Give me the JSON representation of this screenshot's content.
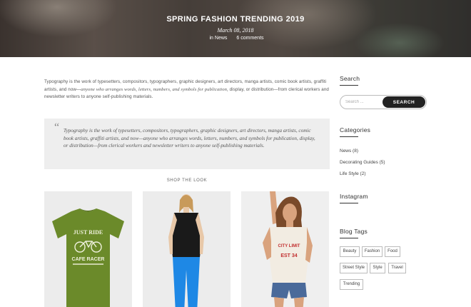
{
  "hero": {
    "title": "SPRING FASHION TRENDING 2019",
    "date": "March 08, 2018",
    "in_label": "in",
    "category": "News",
    "comments": "6 comments"
  },
  "article": {
    "intro_plain": "Typography is the work of typesetters, compositors, typographers, graphic designers, art directors, manga artists, comic book artists, graffiti artists, and now—",
    "intro_italic": "anyone who arranges words, letters, numbers, and symbols for publication,",
    "intro_tail": " display, or distribution—from clerical workers and newsletter writers to anyone self-publishing materials.",
    "quote_mark": "“",
    "quote": "Typography is the work of typesetters, compositors, typographers, graphic designers, art directors, manga artists, comic book artists, graffiti artists, and now—anyone who arranges words, letters, numbers, and symbols for publication, display, or distribution—from clerical workers and newsletter writers to anyone self-publishing materials.",
    "shop_label": "SHOP THE LOOK",
    "tshirt_line1": "JUST RIDE",
    "tshirt_line2": "CAFE RACER",
    "top_line1": "CITY LIMIT",
    "top_line2": "EST 34"
  },
  "sidebar": {
    "search_title": "Search",
    "search_placeholder": "Search ...",
    "search_button": "SEARCH",
    "categories_title": "Categories",
    "categories": [
      {
        "label": "News (8)"
      },
      {
        "label": "Decorating Guides (5)"
      },
      {
        "label": "Life Style (2)"
      }
    ],
    "instagram_title": "Instagram",
    "tags_title": "Blog Tags",
    "tags": [
      "Beauty",
      "Fashion",
      "Food",
      "Street Style",
      "Style",
      "Travel",
      "Trending"
    ]
  },
  "colors": {
    "accent": "#222222",
    "tshirt": "#6b8a2a",
    "leggings": "#1e88e5",
    "shorts": "#4a6a9a"
  }
}
